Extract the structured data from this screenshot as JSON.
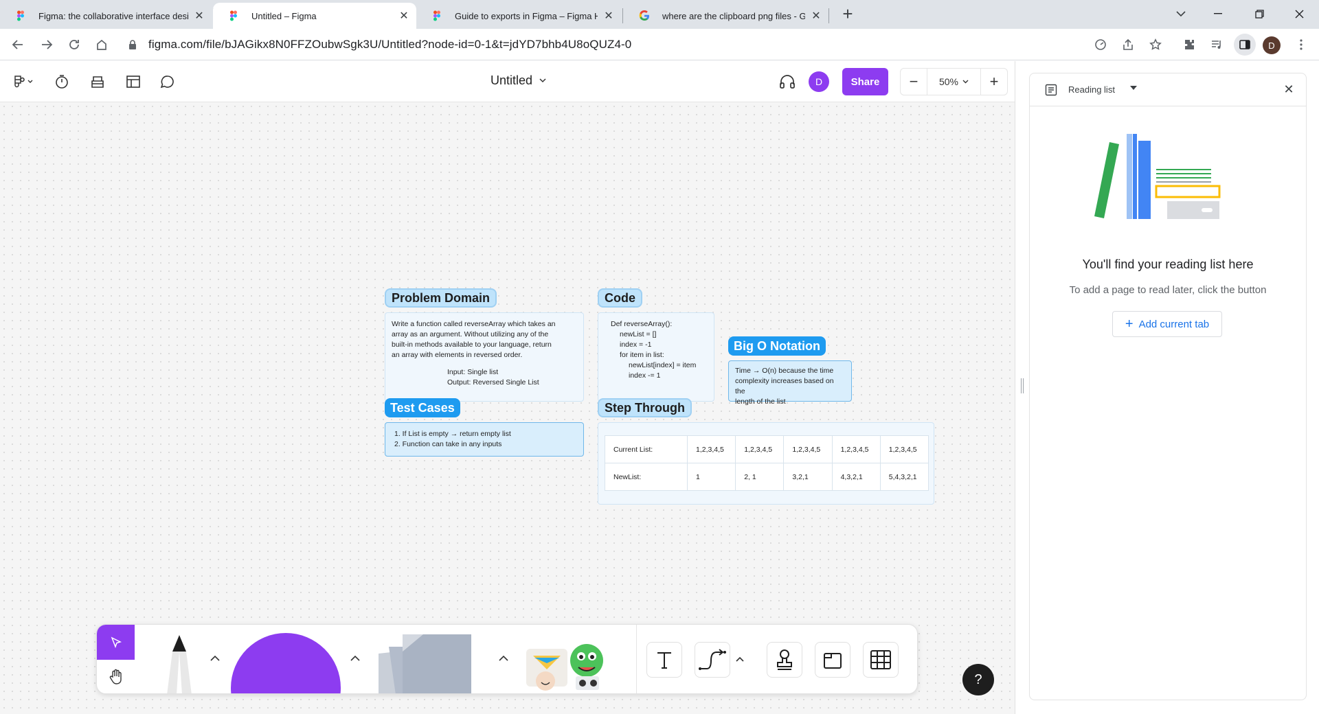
{
  "browser": {
    "tabs": [
      {
        "title": "Figma: the collaborative interface desig",
        "icon": "figma-icon",
        "active": false
      },
      {
        "title": "Untitled – Figma",
        "icon": "figma-icon",
        "active": true
      },
      {
        "title": "Guide to exports in Figma – Figma Help",
        "icon": "figma-icon",
        "active": false
      },
      {
        "title": "where are the clipboard png files - Goo",
        "icon": "google-icon",
        "active": false
      }
    ],
    "new_tab": "+",
    "url": "figma.com/file/bJAGikx8N0FFZOubwSgk3U/Untitled?node-id=0-1&t=jdYD7bhb4U8oQUZ4-0",
    "profile_initial": "D"
  },
  "figma": {
    "doc_title": "Untitled",
    "avatar_initial": "D",
    "share_label": "Share",
    "zoom": "50%",
    "zoom_minus": "−",
    "zoom_plus": "+",
    "accent": "#8d3cf0"
  },
  "board": {
    "problem_domain": {
      "label": "Problem Domain",
      "body": [
        "Write a function called reverseArray which takes an",
        "array as an argument. Without utilizing any of the",
        "built-in methods available to your language, return",
        "an array with elements in reversed order."
      ],
      "input": "Input: Single list",
      "output": "Output: Reversed Single List"
    },
    "code": {
      "label": "Code",
      "lines": [
        "Def reverseArray():",
        "newList = []",
        "index = -1",
        "for item in list:",
        "newList[index] = item",
        "index -= 1"
      ]
    },
    "big_o": {
      "label": "Big O Notation",
      "body": [
        "Time → O(n) because the time",
        "complexity increases based on the",
        "length of the list"
      ]
    },
    "test_cases": {
      "label": "Test Cases",
      "items": [
        "1.  If List is empty → return empty list",
        "2.  Function can take in any inputs"
      ]
    },
    "step_through": {
      "label": "Step Through",
      "rows": [
        {
          "label": "Current List:",
          "cells": [
            "1,2,3,4,5",
            "1,2,3,4,5",
            "1,2,3,4,5",
            "1,2,3,4,5",
            "1,2,3,4,5"
          ]
        },
        {
          "label": "NewList:",
          "cells": [
            "1",
            "2, 1",
            "3,2,1",
            "4,3,2,1",
            "5,4,3,2,1"
          ]
        }
      ]
    },
    "label_blue": "#1e9bf0",
    "label_light": "#bfe3fb"
  },
  "help_label": "?",
  "reading_list": {
    "title": "Reading list",
    "heading": "You'll find your reading list here",
    "sub": "To add a page to read later, click the button",
    "add_label": "Add current tab"
  }
}
